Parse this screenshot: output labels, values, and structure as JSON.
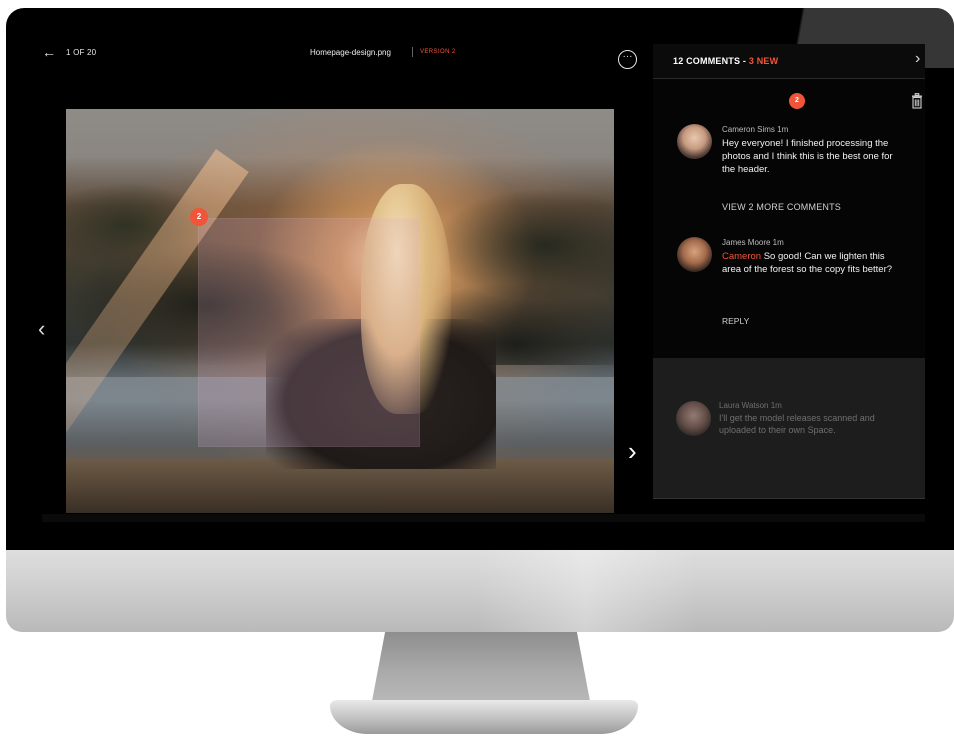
{
  "topbar": {
    "counter": "1 OF 20",
    "filename": "Homepage-design.png",
    "version": "VERSION 2"
  },
  "icons": {
    "back": "←",
    "more": "···",
    "prev": "‹",
    "next": "›",
    "close": "›"
  },
  "annotation": {
    "pin_number": "2"
  },
  "comments_panel": {
    "title": "12 COMMENTS - ",
    "new_label": "3 NEW",
    "pin_number": "2",
    "view_more": "VIEW 2 MORE COMMENTS",
    "reply": "REPLY",
    "comments": [
      {
        "author_line": "Cameron Sims  1m",
        "text": "Hey everyone! I finished processing the photos and I think this is the best one for the header."
      },
      {
        "author_line": "James Moore  1m",
        "mention": "Cameron",
        "text": " So good! Can we lighten this area of the forest so the copy fits better?"
      },
      {
        "author_line": "Laura Watson  1m",
        "text": "I'll get the model releases scanned and uploaded to their own Space."
      }
    ]
  },
  "colors": {
    "accent": "#f0553a",
    "panel_bg": "#000000",
    "panel_lower_bg": "#1d1d1d"
  }
}
